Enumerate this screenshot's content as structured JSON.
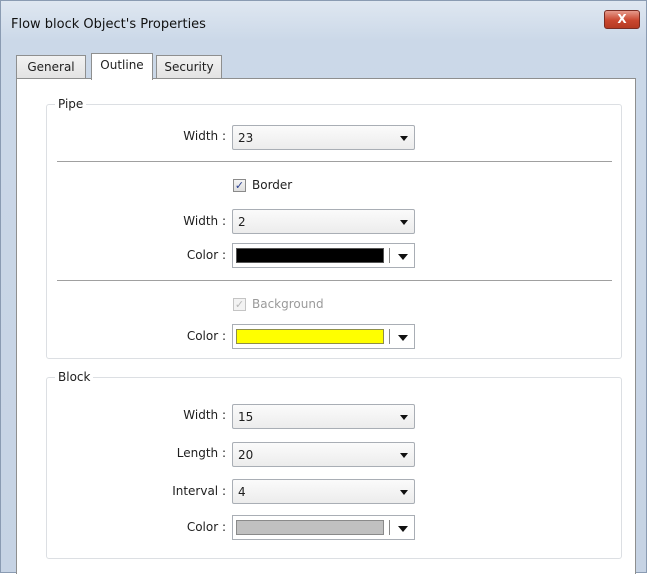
{
  "window": {
    "title": "Flow block Object's Properties",
    "close_glyph": "X"
  },
  "tabs": [
    {
      "label": "General",
      "active": false
    },
    {
      "label": "Outline",
      "active": true
    },
    {
      "label": "Security",
      "active": false
    }
  ],
  "pipe": {
    "legend": "Pipe",
    "width_label": "Width :",
    "width_value": "23",
    "border": {
      "label": "Border",
      "checked": true,
      "width_label": "Width :",
      "width_value": "2",
      "color_label": "Color :",
      "color": "#000000"
    },
    "background": {
      "label": "Background",
      "checked": true,
      "enabled": false,
      "color_label": "Color :",
      "color": "#ffff00"
    }
  },
  "block": {
    "legend": "Block",
    "width_label": "Width :",
    "width_value": "15",
    "length_label": "Length :",
    "length_value": "20",
    "interval_label": "Interval :",
    "interval_value": "4",
    "color_label": "Color :",
    "color": "#c0c0c0"
  }
}
